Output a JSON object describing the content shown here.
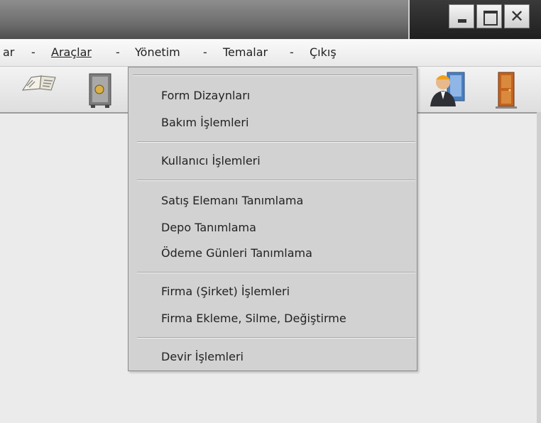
{
  "menubar": {
    "items": [
      "ar",
      "-",
      "Araçlar",
      "-",
      "Yönetim",
      "-",
      "Temalar",
      "-",
      "Çıkış"
    ]
  },
  "window_controls": {
    "close_glyph": "✕"
  },
  "toolbar": {
    "icons": [
      "book-icon",
      "safe-icon",
      "person-icon",
      "door-icon"
    ]
  },
  "dropdown": {
    "items": [
      "Form Dizaynları",
      "Bakım İşlemleri",
      "Kullanıcı İşlemleri",
      "Satış Elemanı Tanımlama",
      "Depo Tanımlama",
      "Ödeme Günleri Tanımlama",
      "Firma (Şirket) İşlemleri",
      "Firma Ekleme, Silme, Değiştirme",
      "Devir İşlemleri"
    ]
  },
  "colors": {
    "titlebar": "#6e6e6e",
    "menu_bg": "#d2d2d2",
    "content_bg": "#ebebeb"
  }
}
